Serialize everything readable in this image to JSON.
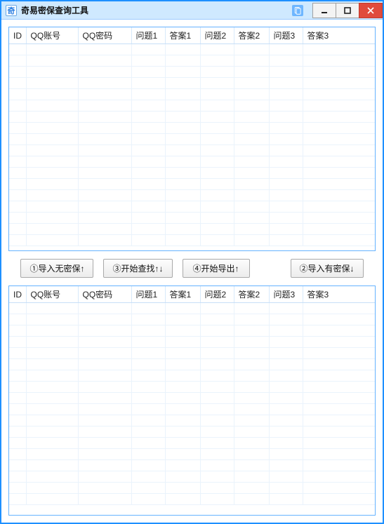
{
  "window": {
    "title": "奇易密保查询工具"
  },
  "columns": {
    "id": "ID",
    "acc": "QQ账号",
    "pwd": "QQ密码",
    "q1": "问题1",
    "a1": "答案1",
    "q2": "问题2",
    "a2": "答案2",
    "q3": "问题3",
    "a3": "答案3"
  },
  "buttons": {
    "import_nosecure": "①导入无密保↑",
    "start_search": "③开始查找↑↓",
    "start_export": "④开始导出↑",
    "import_secure": "②导入有密保↓"
  },
  "top_rows": [],
  "bottom_rows": []
}
